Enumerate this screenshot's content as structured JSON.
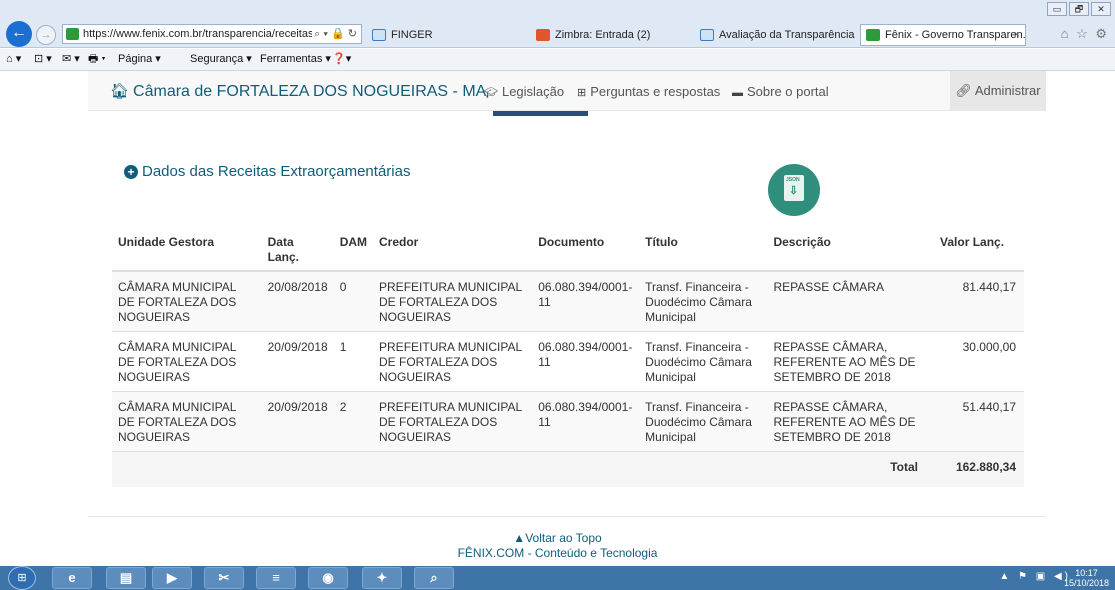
{
  "browser": {
    "window_buttons": [
      "▭",
      "🗗",
      "✕"
    ],
    "address": "https://www.fenix.com.br/transparencia/receitas_e",
    "address_tools": "⌕ ▾ 🔒 ↻",
    "tabs": [
      {
        "label": "FINGER",
        "color": "#cfe3f7"
      },
      {
        "label": "Zimbra: Entrada (2)",
        "color": "#e0562a"
      },
      {
        "label": "Avaliação da Transparência do...",
        "color": "#cfe3f7"
      },
      {
        "label": "Fênix - Governo Transparen...",
        "color": "#2d9a3a",
        "close": "×"
      }
    ],
    "command_bar": [
      "⌂ ▾",
      "⊡ ▾",
      "✉ ▾",
      "🖶 ▾",
      "Página ▾",
      "Segurança ▾",
      "Ferramentas ▾",
      "❓▾"
    ]
  },
  "site": {
    "brand": "Câmara de FORTALEZA DOS NOGUEIRAS - MA",
    "links": [
      {
        "icon": "graduation-cap-icon",
        "label": "Legislação"
      },
      {
        "icon": "sitemap-icon",
        "label": "Perguntas e respostas"
      },
      {
        "icon": "monitor-icon",
        "label": "Sobre o portal"
      }
    ],
    "admin_label": "Administrar"
  },
  "main": {
    "section_title": "Dados das Receitas Extraorçamentárias",
    "json_label": "JSON",
    "table": {
      "headers": [
        "Unidade Gestora",
        "Data Lanç.",
        "DAM",
        "Credor",
        "Documento",
        "Título",
        "Descrição",
        "Valor Lanç."
      ],
      "rows": [
        [
          "CÂMARA MUNICIPAL DE FORTALEZA DOS NOGUEIRAS",
          "20/08/2018",
          "0",
          "PREFEITURA MUNICIPAL DE FORTALEZA DOS NOGUEIRAS",
          "06.080.394/0001-11",
          "Transf. Financeira - Duodécimo Câmara Municipal",
          "REPASSE CÂMARA",
          "81.440,17"
        ],
        [
          "CÂMARA MUNICIPAL DE FORTALEZA DOS NOGUEIRAS",
          "20/09/2018",
          "1",
          "PREFEITURA MUNICIPAL DE FORTALEZA DOS NOGUEIRAS",
          "06.080.394/0001-11",
          "Transf. Financeira - Duodécimo Câmara Municipal",
          "REPASSE CÂMARA, REFERENTE AO MÊS DE SETEMBRO DE 2018",
          "30.000,00"
        ],
        [
          "CÂMARA MUNICIPAL DE FORTALEZA DOS NOGUEIRAS",
          "20/09/2018",
          "2",
          "PREFEITURA MUNICIPAL DE FORTALEZA DOS NOGUEIRAS",
          "06.080.394/0001-11",
          "Transf. Financeira - Duodécimo Câmara Municipal",
          "REPASSE CÂMARA, REFERENTE AO MÊS DE SETEMBRO DE 2018",
          "51.440,17"
        ]
      ],
      "total_label": "Total",
      "total_value": "162.880,34"
    }
  },
  "footer": {
    "back_to_top": "Voltar ao Topo",
    "company": "FÊNIX.COM - Conteúdo e Tecnologia"
  },
  "taskbar": {
    "tray": "▲ ⚑ ▣ ◀)",
    "time": "10:17",
    "date": "15/10/2018"
  },
  "colors": {
    "brand": "#0f5d7a",
    "json_button": "#2f8f7c",
    "taskbar": "#3f74a8"
  }
}
